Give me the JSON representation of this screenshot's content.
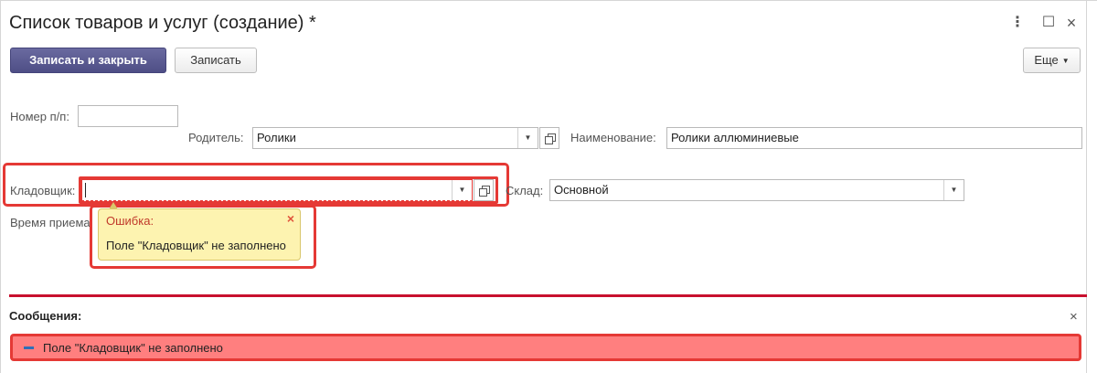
{
  "window": {
    "title": "Список товаров и услуг (создание) *"
  },
  "toolbar": {
    "save_close_label": "Записать и закрыть",
    "save_label": "Записать",
    "more_label": "Еще"
  },
  "form": {
    "number_label": "Номер п/п:",
    "number_value": "",
    "parent_label": "Родитель:",
    "parent_value": "Ролики",
    "name_label": "Наименование:",
    "name_value": "Ролики аллюминиевые",
    "storekeeper_label": "Кладовщик:",
    "storekeeper_value": "",
    "warehouse_label": "Склад:",
    "warehouse_value": "Основной",
    "time_label": "Время приема"
  },
  "error_tooltip": {
    "title": "Ошибка:",
    "text": "Поле \"Кладовщик\" не заполнено"
  },
  "messages": {
    "header": "Сообщения",
    "items": [
      {
        "text": "Поле \"Кладовщик\" не заполнено"
      }
    ]
  },
  "colors": {
    "primary_button": "#55558c",
    "error_frame": "#e53935",
    "message_bg": "#ff7f7f",
    "tooltip_bg": "#fdf3b0",
    "divider": "#c8102e"
  }
}
